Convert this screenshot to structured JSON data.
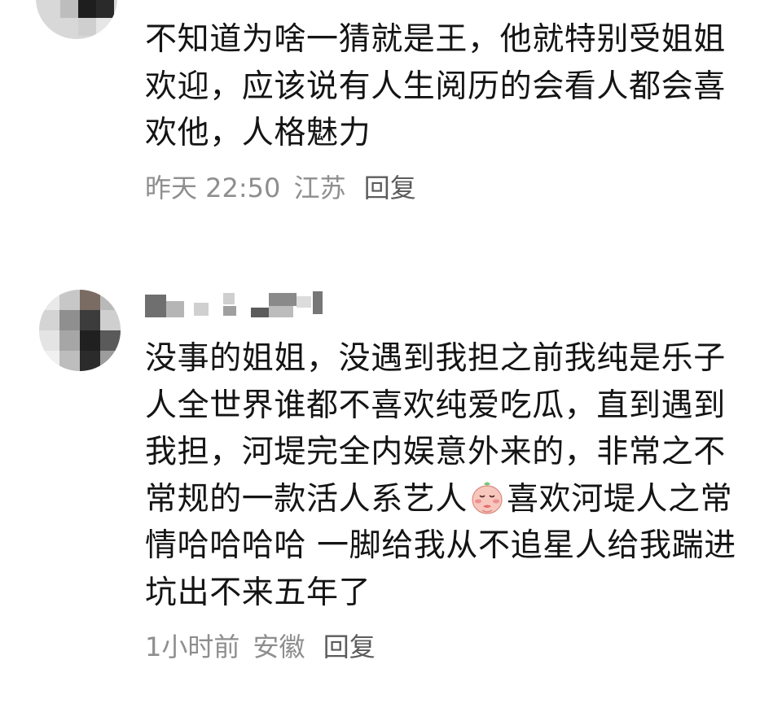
{
  "comments": [
    {
      "text": "不知道为啥一猜就是王，他就特别受姐姐欢迎，应该说有人生阅历的会看人都会喜欢他，人格魅力",
      "time": "昨天 22:50",
      "location": "江苏",
      "reply_label": "回复"
    },
    {
      "text_before_emoji": "没事的姐姐，没遇到我担之前我纯是乐子人全世界谁都不喜欢纯爱吃瓜，直到遇到我担，河堤完全内娱意外来的，非常之不常规的一款活人系艺人",
      "emoji_icon": "shy-face-emoji-icon",
      "text_after_emoji": "喜欢河堤人之常情哈哈哈哈 一脚给我从不追星人给我踹进坑出不来五年了",
      "time": "1小时前",
      "location": "安徽",
      "reply_label": "回复"
    }
  ],
  "colors": {
    "text": "#141414",
    "meta": "#8e8e8e",
    "background": "#ffffff"
  }
}
